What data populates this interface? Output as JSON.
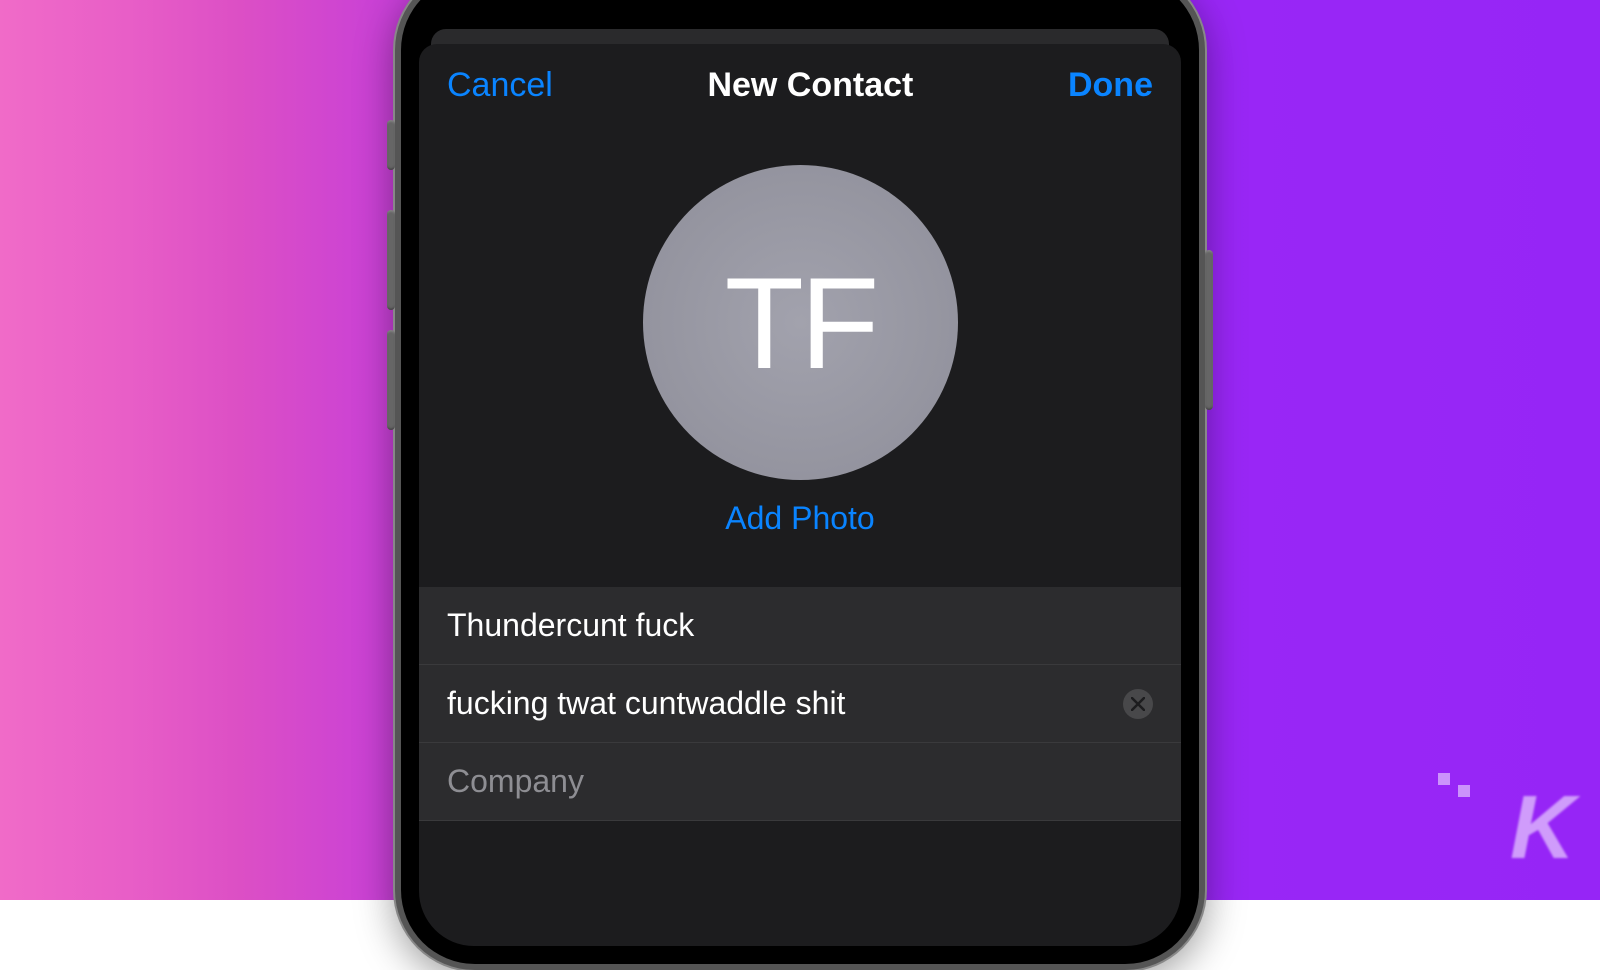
{
  "nav": {
    "cancel": "Cancel",
    "title": "New Contact",
    "done": "Done"
  },
  "avatar": {
    "initials": "TF",
    "add_photo": "Add Photo"
  },
  "fields": {
    "first_name": "Thundercunt fuck",
    "last_name": "fucking twat cuntwaddle shit",
    "company_placeholder": "Company",
    "company_value": ""
  },
  "watermark": "K"
}
